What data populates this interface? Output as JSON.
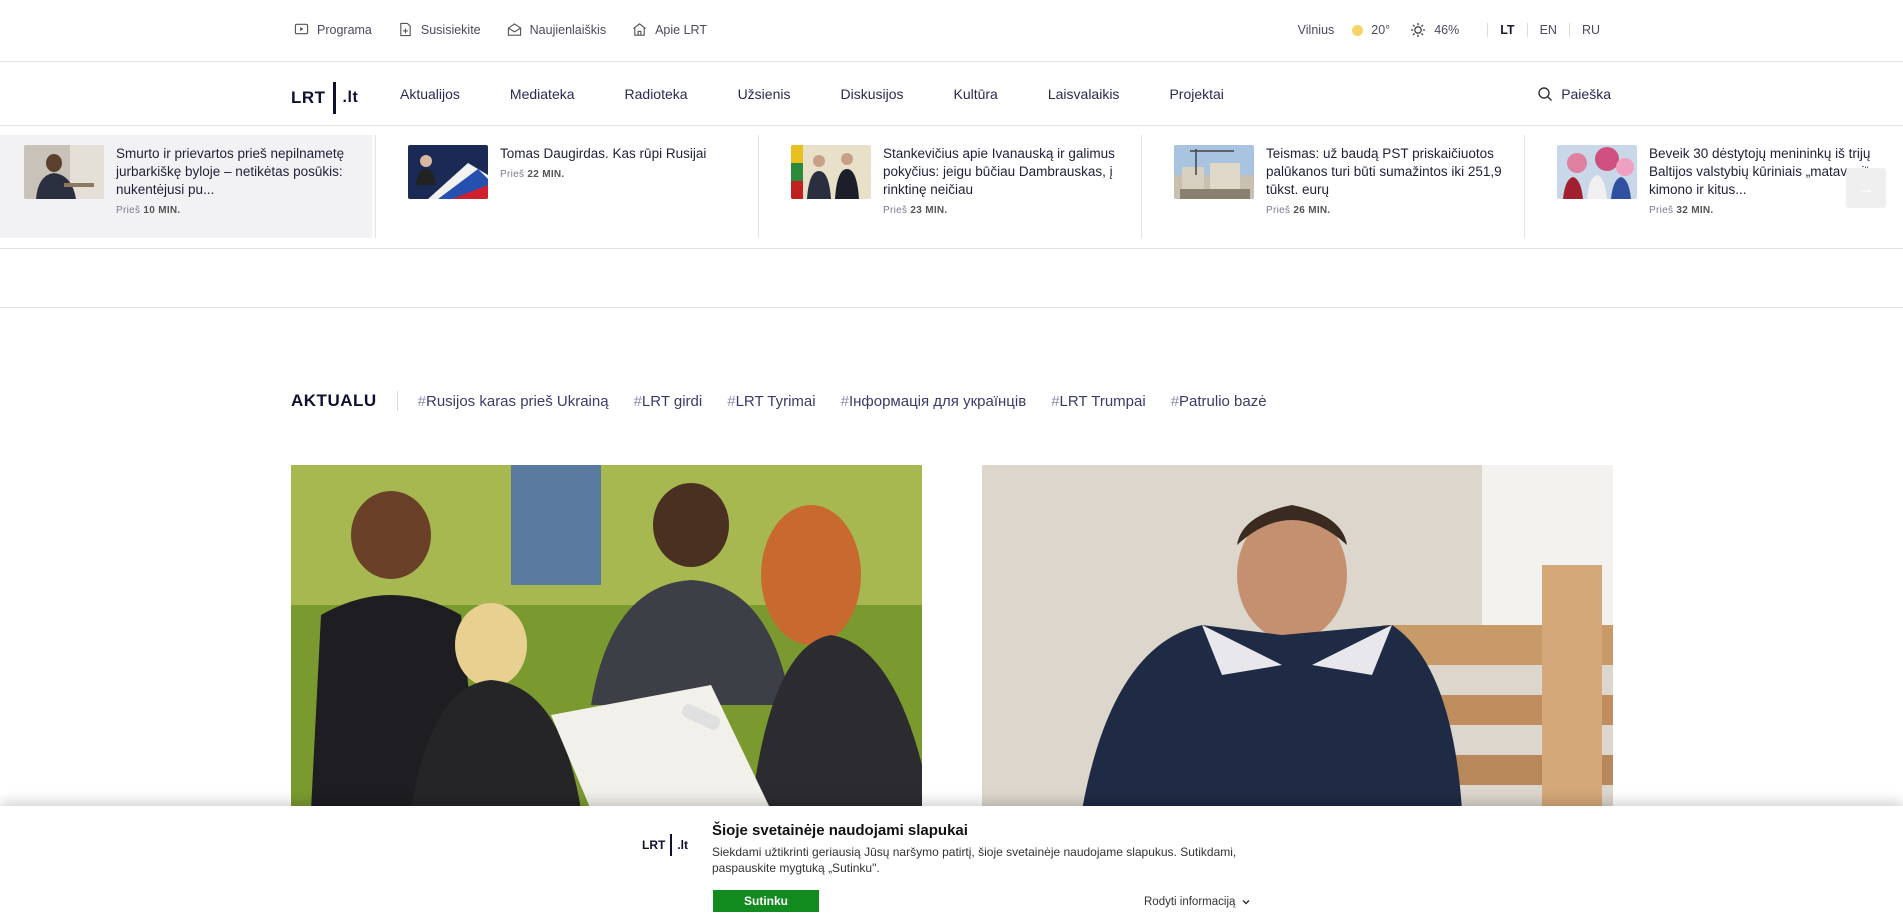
{
  "topbar": {
    "links": [
      {
        "label": "Programa",
        "icon": "play-icon"
      },
      {
        "label": "Susisiekite",
        "icon": "contact-icon"
      },
      {
        "label": "Naujienlaiškis",
        "icon": "envelope-icon"
      },
      {
        "label": "Apie LRT",
        "icon": "building-icon"
      }
    ],
    "city": "Vilnius",
    "temperature": "20°",
    "air_quality": "46%",
    "languages": [
      "LT",
      "EN",
      "RU"
    ],
    "active_language": "LT"
  },
  "nav": {
    "logo_main": "LRT",
    "logo_tld": ".lt",
    "items": [
      "Aktualijos",
      "Mediateka",
      "Radioteka",
      "Užsienis",
      "Diskusijos",
      "Kultūra",
      "Laisvalaikis",
      "Projektai"
    ],
    "search_label": "Paieška"
  },
  "latest": [
    {
      "title": "Smurto ir prievartos prieš nepilnametę jurbarkiškę byloje – netikėtas posūkis: nukentėjusi pu...",
      "time_prefix": "Prieš",
      "time": "10 MIN."
    },
    {
      "title": "Tomas Daugirdas. Kas rūpi Rusijai",
      "time_prefix": "Prieš",
      "time": "22 MIN."
    },
    {
      "title": "Stankevičius apie Ivanauską ir galimus pokyčius: jeigu būčiau Dambrauskas, į rinktinę neičiau",
      "time_prefix": "Prieš",
      "time": "23 MIN."
    },
    {
      "title": "Teismas: už baudą PST priskaičiuotos palūkanos turi būti sumažintos iki 251,9 tūkst. eurų",
      "time_prefix": "Prieš",
      "time": "26 MIN."
    },
    {
      "title": "Beveik 30 dėstytojų menininkų iš trijų Baltijos valstybių kūriniais „matavosi“ kimono ir kitus...",
      "time_prefix": "Prieš",
      "time": "32 MIN."
    }
  ],
  "aktualu": {
    "title": "AKTUALU",
    "tags": [
      "Rusijos karas prieš Ukrainą",
      "LRT girdi",
      "LRT Tyrimai",
      "Інформація для українців",
      "LRT Trumpai",
      "Patrulio bazė"
    ]
  },
  "cookie": {
    "logo_main": "LRT",
    "logo_tld": ".lt",
    "title": "Šioje svetainėje naudojami slapukai",
    "text": "Siekdami užtikrinti geriausią Jūsų naršymo patirtį, šioje svetainėje naudojame slapukus. Sutikdami, paspauskite mygtuką „Sutinku\".",
    "accept_label": "Sutinku",
    "more_label": "Rodyti informaciją"
  }
}
